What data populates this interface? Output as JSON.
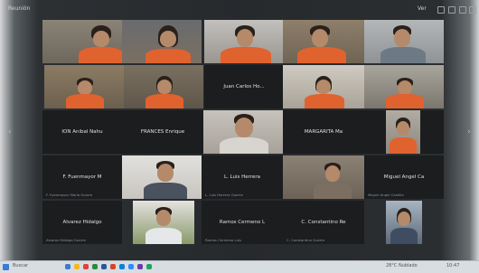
{
  "window": {
    "title": "Reunión",
    "view_label": "Ver"
  },
  "participants": [
    {
      "name": "",
      "sub": ""
    },
    {
      "name": "",
      "sub": ""
    },
    {
      "name": "",
      "sub": ""
    },
    {
      "name": "",
      "sub": ""
    },
    {
      "name": "",
      "sub": ""
    },
    {
      "name": "",
      "sub": ""
    },
    {
      "name": "",
      "sub": ""
    },
    {
      "name": "Juan Carlos Ho...",
      "sub": ""
    },
    {
      "name": "",
      "sub": ""
    },
    {
      "name": "",
      "sub": ""
    },
    {
      "name": "ION Anibal Nahu",
      "sub": ""
    },
    {
      "name": "FRANCES Enrique",
      "sub": ""
    },
    {
      "name": "",
      "sub": ""
    },
    {
      "name": "MARGARITA Ma",
      "sub": ""
    },
    {
      "name": "",
      "sub": ""
    },
    {
      "name": "F. Fuenmayor M",
      "sub": "F. Fuenmayor Maria Guerre"
    },
    {
      "name": "",
      "sub": ""
    },
    {
      "name": "L. Luis Herrera",
      "sub": "L. Luis Herrera Guerre"
    },
    {
      "name": "",
      "sub": ""
    },
    {
      "name": "Miguel Angel Ca",
      "sub": "Miguel Angel Castillo"
    },
    {
      "name": "Alvarez Hidalgo",
      "sub": "Alvarez Hidalgo Guerre"
    },
    {
      "name": "",
      "sub": ""
    },
    {
      "name": "Ramos Cermeno L",
      "sub": "Ramos Cermeno Luis"
    },
    {
      "name": "C. Constantino Re",
      "sub": "C. Constantino Guerre"
    },
    {
      "name": "",
      "sub": ""
    }
  ],
  "taskbar": {
    "search_placeholder": "Buscar",
    "weather": "28°C Nublado",
    "clock": "10:47"
  },
  "colors": {
    "accent": "#e0622e",
    "tile_bg": "#1b1d1f",
    "screen_bg": "#272a2d"
  },
  "icons": [
    "search-icon",
    "settings-icon",
    "minimize-icon",
    "fullscreen-icon",
    "close-icon",
    "previous-page-icon",
    "next-page-icon"
  ]
}
